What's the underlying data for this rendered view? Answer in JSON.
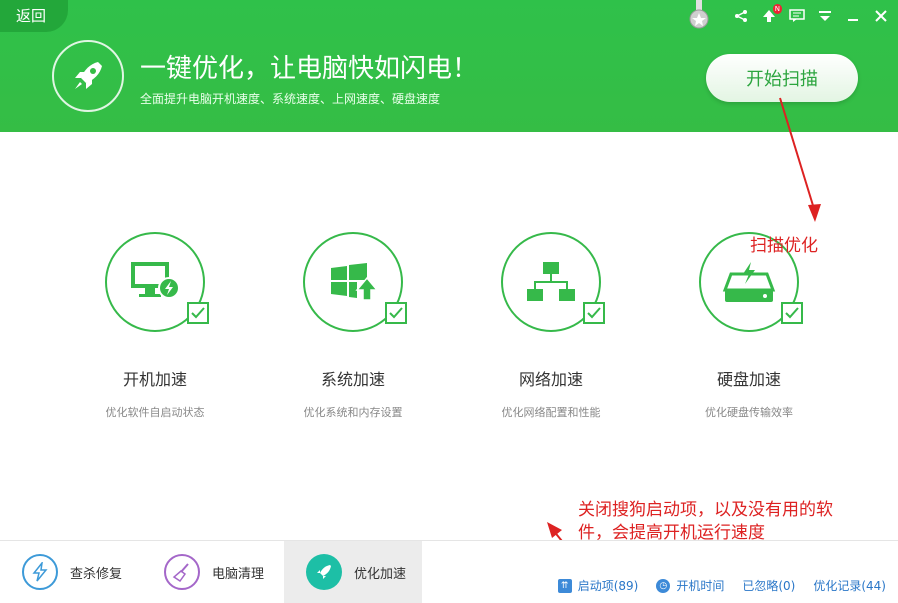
{
  "header": {
    "back_label": "返回",
    "headline": "一键优化，让电脑快如闪电！",
    "subline": "全面提升电脑开机速度、系统速度、上网速度、硬盘速度",
    "scan_label": "开始扫描",
    "badge_letter": "N"
  },
  "cards": [
    {
      "title": "开机加速",
      "desc": "优化软件自启动状态",
      "icon": "monitor-bolt-icon"
    },
    {
      "title": "系统加速",
      "desc": "优化系统和内存设置",
      "icon": "windows-up-icon"
    },
    {
      "title": "网络加速",
      "desc": "优化网络配置和性能",
      "icon": "network-icon"
    },
    {
      "title": "硬盘加速",
      "desc": "优化硬盘传输效率",
      "icon": "harddisk-bolt-icon"
    }
  ],
  "annotations": {
    "scan_note": "扫描优化",
    "startup_note_line1": "关闭搜狗启动项，以及没有用的软",
    "startup_note_line2": "件，会提高开机运行速度"
  },
  "bottom_nav": [
    {
      "label": "查杀修复",
      "icon": "bolt-shield-icon"
    },
    {
      "label": "电脑清理",
      "icon": "broom-icon"
    },
    {
      "label": "优化加速",
      "icon": "rocket-icon"
    }
  ],
  "stats": {
    "startup": "启动项(89)",
    "boot_time": "开机时间",
    "ignored": "已忽略(0)",
    "history": "优化记录(44)"
  },
  "colors": {
    "brand_green": "#35bd45",
    "annotation_red": "#dd2222",
    "link_blue": "#2a77c8"
  }
}
